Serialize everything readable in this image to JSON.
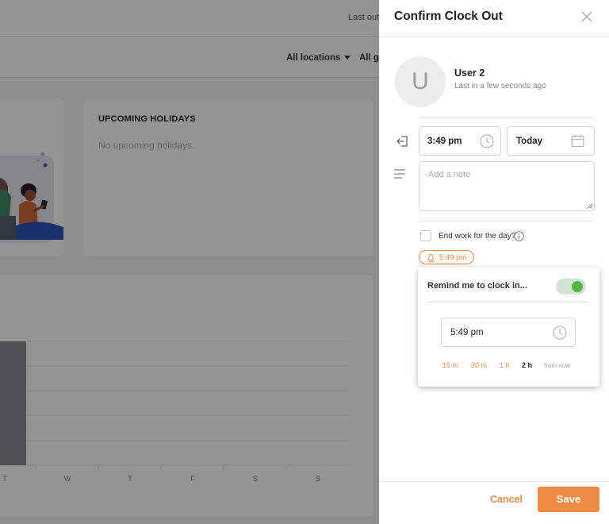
{
  "background": {
    "header": {
      "last_out_text": "Last out"
    },
    "filters": [
      {
        "label": "All locations"
      },
      {
        "label": "All g"
      }
    ],
    "holidays_card": {
      "title": "UPCOMING HOLIDAYS",
      "empty_text": "No upcoming holidays."
    },
    "chart": {
      "type": "bar",
      "x_labels": [
        "T",
        "W",
        "T",
        "F",
        "S",
        "S"
      ],
      "bar_color": "#8a8b8f"
    }
  },
  "panel": {
    "title": "Confirm Clock Out",
    "close_icon": "close-icon",
    "user": {
      "avatar_letter": "U",
      "name": "User 2",
      "subtitle": "Last in a few seconds ago"
    },
    "clock_out": {
      "time": "3:49 pm",
      "date": "Today"
    },
    "note": {
      "placeholder": "Add a note"
    },
    "end_work": {
      "label": "End work for the day?",
      "checked": false
    },
    "reminder_pill": {
      "text": "5:49 pm"
    },
    "reminder_popup": {
      "title": "Remind me to clock in...",
      "enabled": true,
      "time": "5:49 pm",
      "quick_options": [
        "15 m",
        "30 m",
        "1 h",
        "2 h"
      ],
      "selected_option": "2 h",
      "suffix": "from now"
    },
    "footer": {
      "cancel_label": "Cancel",
      "save_label": "Save"
    }
  },
  "colors": {
    "accent": "#f08a45",
    "toggle_on": "#57b443",
    "toggle_track": "#cfe6cc"
  }
}
